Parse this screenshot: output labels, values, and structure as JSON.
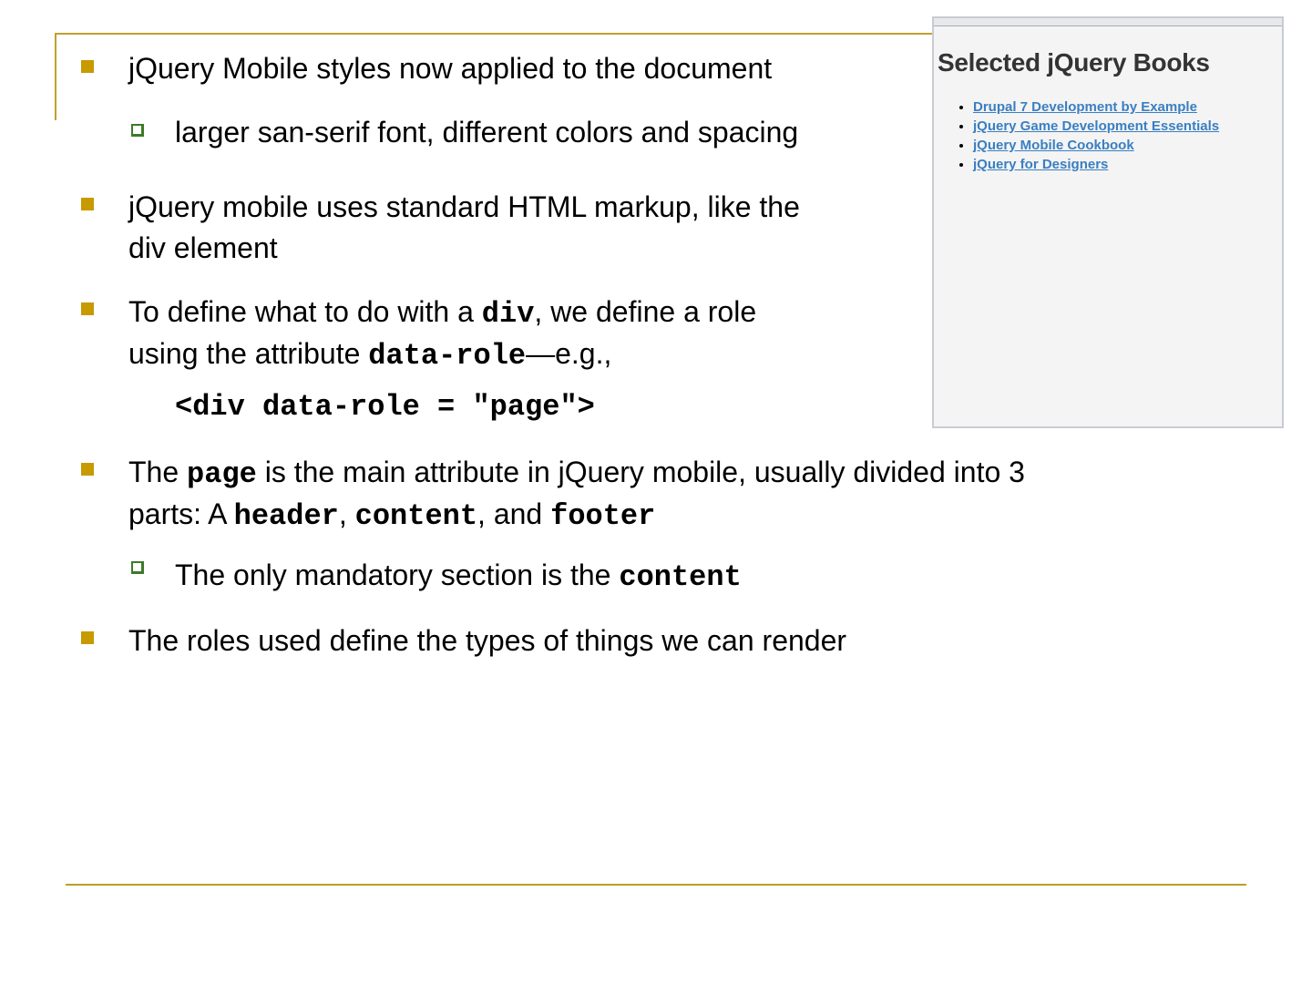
{
  "slide": {
    "bullets": [
      {
        "text": "jQuery Mobile styles now applied to the document"
      },
      {
        "sub": "larger san-serif font, different colors and spacing"
      },
      {
        "line1": "jQuery mobile uses standard HTML markup, like the",
        "line2": "div element"
      },
      {
        "a": "To define what to do with a ",
        "b": "div",
        "c": ", we define a role",
        "d": "using the attribute ",
        "e": "data-role",
        "f": "—e.g.,",
        "code": "<div data-role = \"page\">"
      },
      {
        "a": "The ",
        "b": "page",
        "c": " is the main attribute in jQuery mobile, usually divided into 3",
        "d": "parts: A ",
        "e": "header",
        "f": ", ",
        "g": "content",
        "h": ", and ",
        "i": "footer"
      },
      {
        "a": "The only mandatory section is the ",
        "b": "content"
      },
      {
        "text": "The roles used define the types of things we can render"
      }
    ]
  },
  "inset": {
    "title": "Selected jQuery Books",
    "links": [
      "Drupal 7 Development by Example",
      "jQuery Game Development Essentials",
      "jQuery Mobile Cookbook",
      "jQuery for Designers"
    ]
  }
}
